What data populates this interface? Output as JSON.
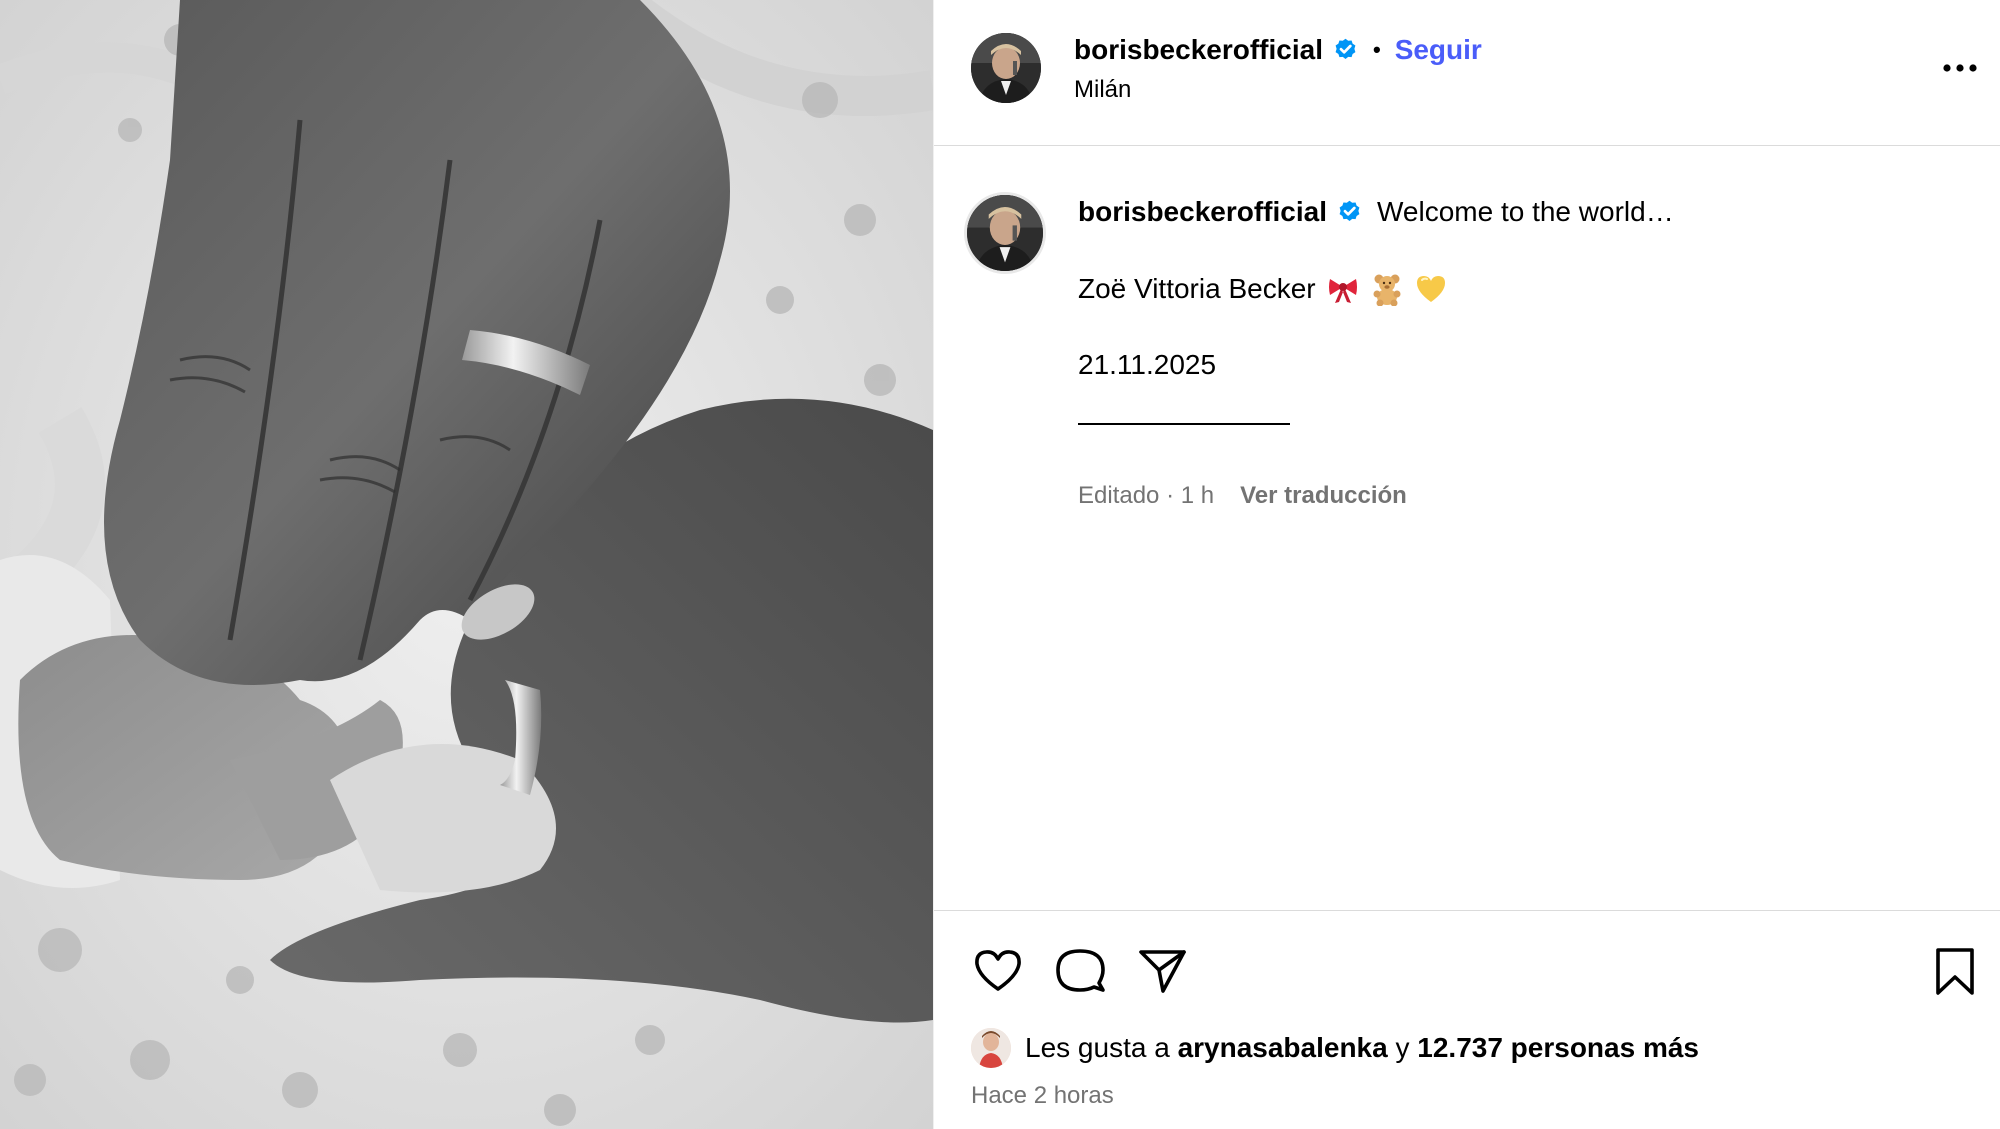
{
  "post": {
    "username": "borisbeckerofficial",
    "separator": "•",
    "follow_label": "Seguir",
    "location": "Milán"
  },
  "caption": {
    "username": "borisbeckerofficial",
    "line1": "Welcome to the world…",
    "name_line": "Zoë Vittoria Becker",
    "emojis": [
      "ribbon-emoji",
      "teddy-bear-emoji",
      "yellow-heart-emoji"
    ],
    "date": "21.11.2025",
    "meta_time": "Editado · 1 h",
    "translate_label": "Ver traducción"
  },
  "engagement": {
    "likes_prefix": "Les gusta a ",
    "liker": "arynasabalenka",
    "likes_mid": " y ",
    "likes_count": "12.737 personas más",
    "time_ago": "Hace 2 horas"
  },
  "icons": {
    "more": "more-horizontal-icon",
    "like": "heart-icon",
    "comment": "comment-bubble-icon",
    "share": "paper-plane-icon",
    "save": "bookmark-icon",
    "verified": "verified-badge-icon"
  },
  "colors": {
    "accent_link": "#4a5df9",
    "verified_blue": "#0095f6",
    "muted_text": "#737373",
    "divider": "#dbdbdb"
  }
}
